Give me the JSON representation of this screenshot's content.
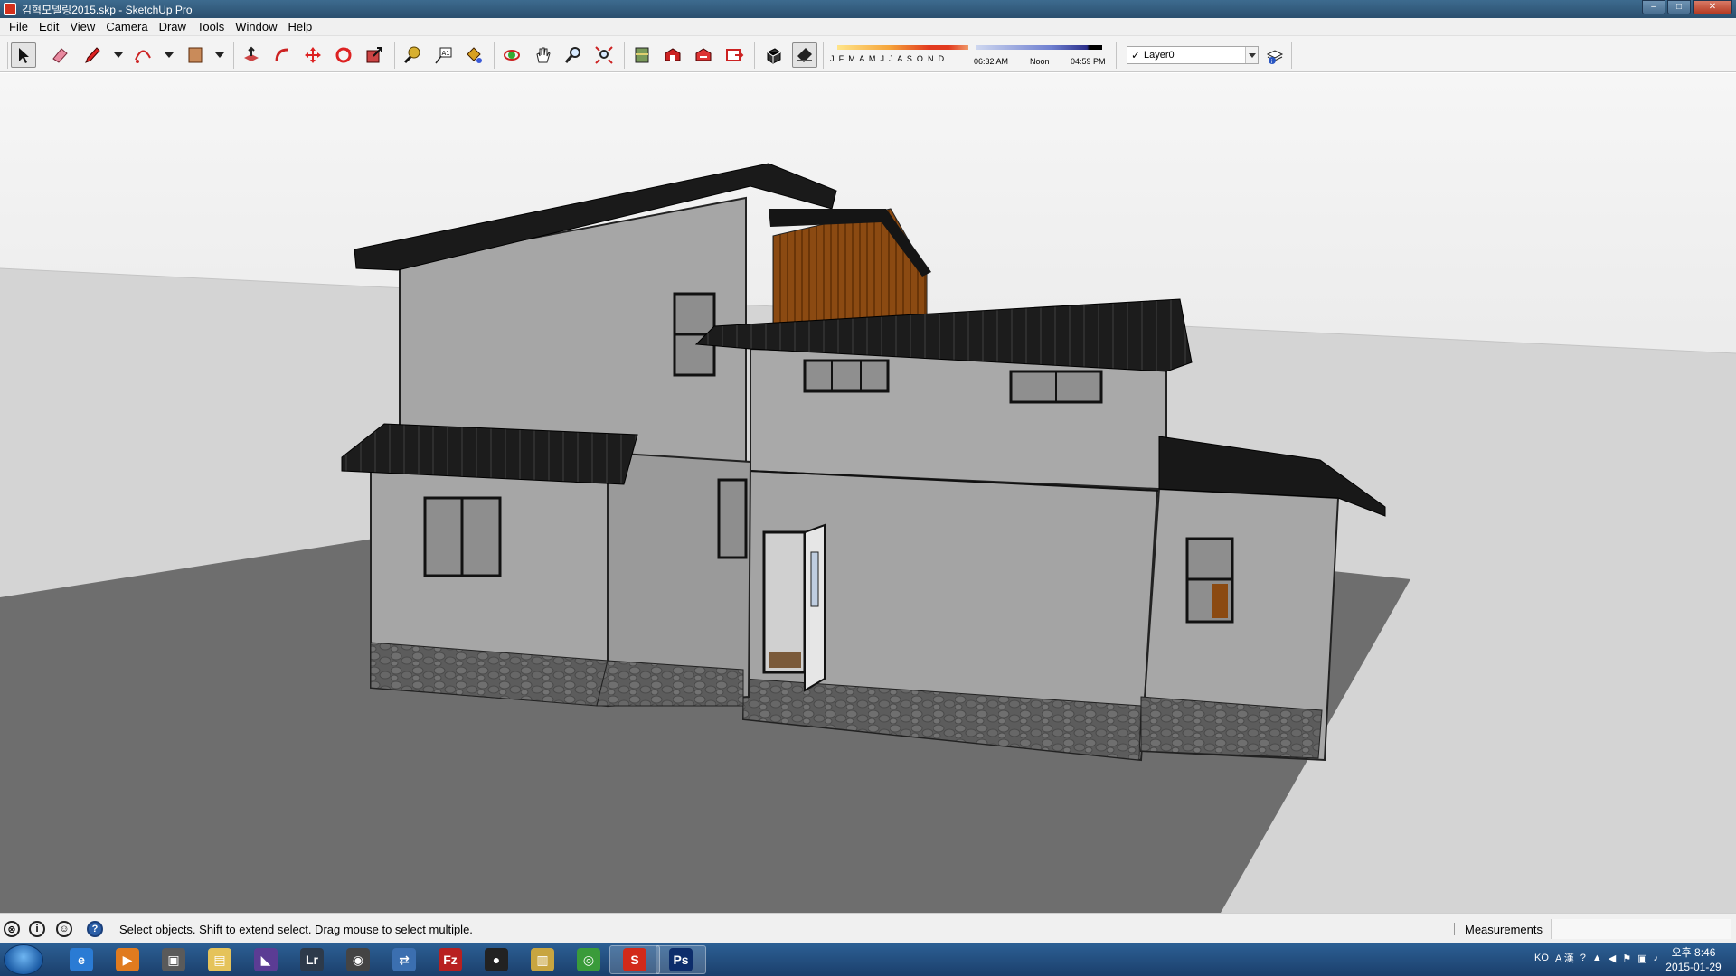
{
  "window": {
    "title": "김혁모델링2015.skp - SketchUp Pro",
    "controls": {
      "minimize": "–",
      "maximize": "□",
      "close": "✕"
    }
  },
  "menu": [
    "File",
    "Edit",
    "View",
    "Camera",
    "Draw",
    "Tools",
    "Window",
    "Help"
  ],
  "toolbar": {
    "tools": [
      {
        "name": "select-tool",
        "icon": "arrow-cursor-icon"
      },
      {
        "name": "eraser-tool",
        "icon": "eraser-icon"
      },
      {
        "name": "line-tool",
        "icon": "pencil-icon"
      },
      {
        "name": "arc-tool",
        "icon": "arc-icon"
      },
      {
        "name": "rectangle-tool",
        "icon": "rectangle-icon"
      },
      {
        "name": "push-pull-tool",
        "icon": "push-pull-icon"
      },
      {
        "name": "follow-me-tool",
        "icon": "follow-me-icon"
      },
      {
        "name": "move-tool",
        "icon": "move-icon"
      },
      {
        "name": "rotate-tool",
        "icon": "rotate-icon"
      },
      {
        "name": "scale-tool",
        "icon": "scale-icon"
      },
      {
        "name": "tape-measure-tool",
        "icon": "tape-measure-icon"
      },
      {
        "name": "text-tool",
        "icon": "text-icon"
      },
      {
        "name": "paint-bucket-tool",
        "icon": "paint-bucket-icon"
      },
      {
        "name": "orbit-tool",
        "icon": "orbit-icon"
      },
      {
        "name": "pan-tool",
        "icon": "pan-icon"
      },
      {
        "name": "zoom-tool",
        "icon": "zoom-icon"
      },
      {
        "name": "zoom-extents-tool",
        "icon": "zoom-extents-icon"
      },
      {
        "name": "add-location-tool",
        "icon": "add-location-icon"
      },
      {
        "name": "3d-warehouse-tool",
        "icon": "warehouse-icon"
      },
      {
        "name": "share-model-tool",
        "icon": "share-model-icon"
      },
      {
        "name": "extension-warehouse-tool",
        "icon": "extension-icon"
      },
      {
        "name": "shadows-toggle",
        "icon": "shadows-icon"
      },
      {
        "name": "fog-toggle",
        "icon": "fog-icon"
      }
    ],
    "shadow_settings": {
      "months": "J F M A M J J A S O N D",
      "time_start": "06:32 AM",
      "time_noon": "Noon",
      "time_end": "04:59 PM"
    },
    "layer": {
      "checked": "✓",
      "name": "Layer0"
    }
  },
  "viewport": {
    "colors": {
      "sky": "#dcdcdc",
      "ground": "#6e6e6e",
      "wall": "#a3a3a3",
      "roof": "#1a1a1a",
      "stone": "#5b5b5b",
      "wood": "#8b4a12"
    }
  },
  "status": {
    "message": "Select objects. Shift to extend select. Drag mouse to select multiple.",
    "measurements_label": "Measurements",
    "measurements_value": ""
  },
  "taskbar": {
    "apps": [
      {
        "name": "internet-explorer",
        "label": "e",
        "color": "#2a7bd4"
      },
      {
        "name": "media-player",
        "label": "▶",
        "color": "#e07b1f"
      },
      {
        "name": "photo-viewer",
        "label": "▣",
        "color": "#5a5a5a"
      },
      {
        "name": "file-explorer",
        "label": "▤",
        "color": "#e5c35a"
      },
      {
        "name": "visual-studio",
        "label": "◣",
        "color": "#5b3c94"
      },
      {
        "name": "lightroom",
        "label": "Lr",
        "color": "#2d3a4a"
      },
      {
        "name": "camera-app",
        "label": "◉",
        "color": "#444"
      },
      {
        "name": "network-app",
        "label": "⇄",
        "color": "#3b6fb0"
      },
      {
        "name": "filezilla",
        "label": "Fz",
        "color": "#b82020"
      },
      {
        "name": "qq",
        "label": "●",
        "color": "#222"
      },
      {
        "name": "archive-app",
        "label": "▥",
        "color": "#c8a540"
      },
      {
        "name": "chrome",
        "label": "◎",
        "color": "#3a9b3a"
      },
      {
        "name": "sketchup",
        "label": "S",
        "color": "#d22a1a"
      },
      {
        "name": "photoshop",
        "label": "Ps",
        "color": "#0d2d6b"
      }
    ],
    "tray": {
      "lang": "KO",
      "ime": "A 漢"
    },
    "clock": {
      "time": "오후 8:46",
      "date": "2015-01-29"
    }
  }
}
